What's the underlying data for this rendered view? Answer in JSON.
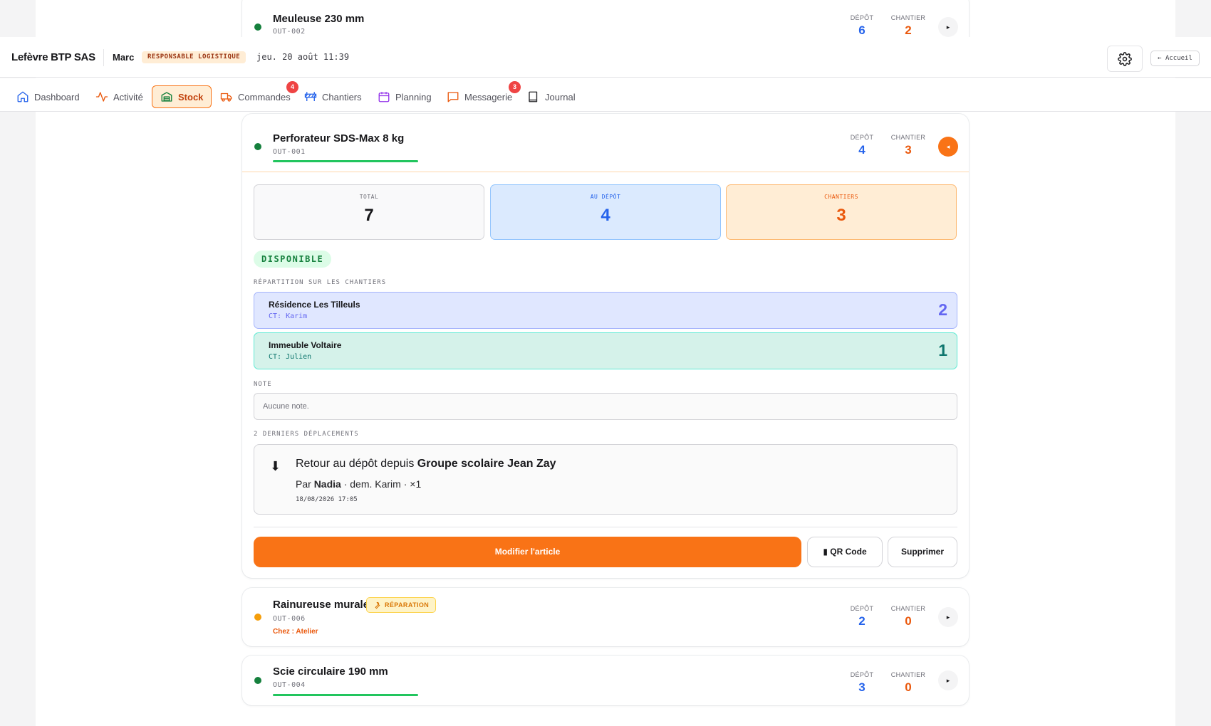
{
  "header": {
    "company": "Lefèvre BTP SAS",
    "user": "Marc",
    "role": "RESPONSABLE LOGISTIQUE",
    "datetime": "jeu. 20 août 11:39",
    "home_label": "← Accueil"
  },
  "nav": {
    "tabs": [
      {
        "label": "Dashboard",
        "icon": "home-icon"
      },
      {
        "label": "Activité",
        "icon": "activity-icon"
      },
      {
        "label": "Stock",
        "icon": "warehouse-icon",
        "active": true
      },
      {
        "label": "Commandes",
        "icon": "truck-icon",
        "badge": "4"
      },
      {
        "label": "Chantiers",
        "icon": "barrier-icon"
      },
      {
        "label": "Planning",
        "icon": "calendar-icon"
      },
      {
        "label": "Messagerie",
        "icon": "message-icon",
        "badge": "3"
      },
      {
        "label": "Journal",
        "icon": "book-icon"
      }
    ]
  },
  "labels": {
    "depot": "DÉPÔT",
    "chantier": "CHANTIER"
  },
  "items": {
    "meuleuse": {
      "name": "Meuleuse 230 mm",
      "ref": "OUT-002",
      "depot": "6",
      "chantier": "2"
    },
    "perforateur": {
      "name": "Perforateur SDS-Max 8 kg",
      "ref": "OUT-001",
      "depot": "4",
      "chantier": "3"
    },
    "rainureuse": {
      "name": "Rainureuse murale",
      "ref": "OUT-006",
      "badge": "RÉPARATION",
      "location": "Chez : Atelier",
      "depot": "2",
      "chantier": "0"
    },
    "scie": {
      "name": "Scie circulaire 190 mm",
      "ref": "OUT-004",
      "depot": "3",
      "chantier": "0"
    }
  },
  "detail": {
    "kpis": {
      "total_label": "TOTAL",
      "total": "7",
      "depot_label": "AU DÉPÔT",
      "depot": "4",
      "chantiers_label": "CHANTIERS",
      "chantiers": "3"
    },
    "status": "DISPONIBLE",
    "repartition_label": "RÉPARTITION SUR LES CHANTIERS",
    "sites": [
      {
        "name": "Résidence Les Tilleuls",
        "ct": "CT: Karim",
        "count": "2"
      },
      {
        "name": "Immeuble Voltaire",
        "ct": "CT: Julien",
        "count": "1"
      }
    ],
    "note_label": "NOTE",
    "note_placeholder": "Aucune note.",
    "moves_label": "2 DERNIERS DÉPLACEMENTS",
    "move": {
      "title_prefix": "Retour au dépôt depuis",
      "title_site": "Groupe scolaire Jean Zay",
      "by_prefix": "Par",
      "by_name": "Nadia",
      "by_suffix": "· dem. Karim · ×1",
      "date": "18/08/2026 17:05"
    },
    "actions": {
      "edit": "Modifier l'article",
      "qr": "QR Code",
      "delete": "Supprimer"
    }
  },
  "colors": {
    "accent": "#f97316",
    "depot": "#2563eb",
    "chantier": "#ea580c",
    "available": "#15803d"
  }
}
